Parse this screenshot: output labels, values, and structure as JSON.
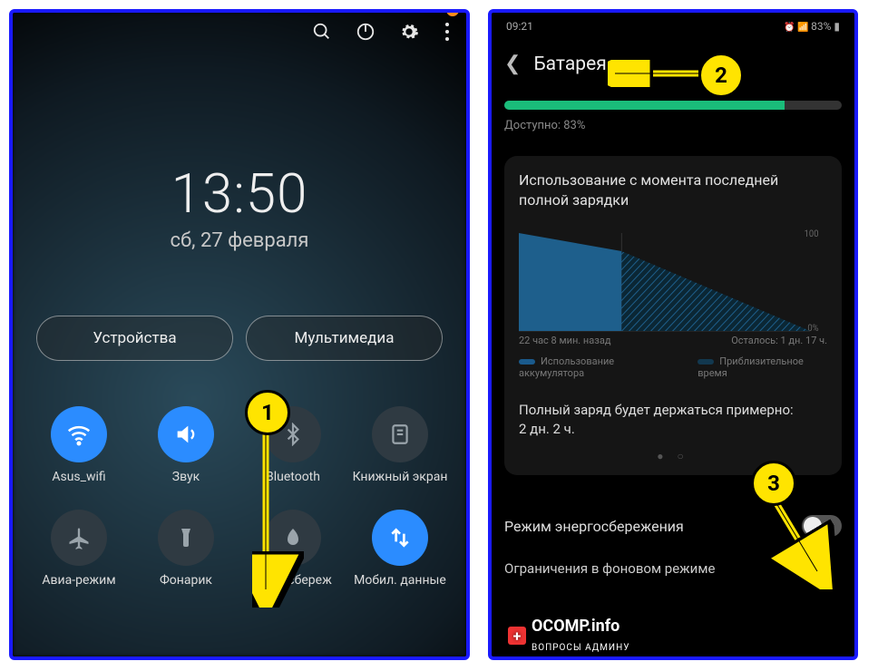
{
  "phone1": {
    "time": "13:50",
    "date": "сб, 27 февраля",
    "chips": {
      "devices": "Устройства",
      "media": "Мультимедиа"
    },
    "tiles": [
      {
        "key": "wifi",
        "label": "Asus_wifi",
        "active": true
      },
      {
        "key": "sound",
        "label": "Звук",
        "active": true
      },
      {
        "key": "bluetooth",
        "label": "Bluetooth",
        "active": false
      },
      {
        "key": "reader",
        "label": "Книжный экран",
        "active": false
      },
      {
        "key": "airplane",
        "label": "Авиа-режим",
        "active": false
      },
      {
        "key": "flashlight",
        "label": "Фонарик",
        "active": false
      },
      {
        "key": "powersave",
        "label": "нергосбереж",
        "active": false
      },
      {
        "key": "data",
        "label": "Мобил. данные",
        "active": true
      }
    ]
  },
  "phone2": {
    "status_time": "09:21",
    "status_bat": "83%",
    "title": "Батарея",
    "available": "Доступно: 83%",
    "card_heading": "Использование с момента последней полной зарядки",
    "chart_left": "22 час 8 мин. назад",
    "chart_right": "Осталось: 1 дн. 17 ч.",
    "legend_a": "Использование аккумулятора",
    "legend_b": "Приблизительное время",
    "estimate_line1": "Полный заряд будет держаться примерно:",
    "estimate_line2": "2 дн. 2 ч.",
    "row_power_save": "Режим энергосбережения",
    "row_background": "Ограничения в фоновом режиме"
  },
  "badges": {
    "b1": "1",
    "b2": "2",
    "b3": "3"
  },
  "watermark": {
    "brand": "OCOMP.info",
    "sub": "ВОПРОСЫ АДМИНУ"
  },
  "chart_data": {
    "type": "area",
    "title": "Использование с момента последней полной зарядки",
    "ylabel": "%",
    "ylim": [
      0,
      100
    ],
    "series": [
      {
        "name": "Использование аккумулятора",
        "values": [
          100,
          98,
          96,
          93,
          90,
          87,
          85,
          83
        ]
      },
      {
        "name": "Приблизительное время",
        "values": [
          83,
          70,
          55,
          40,
          28,
          18,
          10,
          3,
          0
        ]
      }
    ],
    "x_left_label": "22 час 8 мин. назад",
    "x_right_label": "Осталось: 1 дн. 17 ч.",
    "y_ticks": [
      0,
      100
    ]
  }
}
